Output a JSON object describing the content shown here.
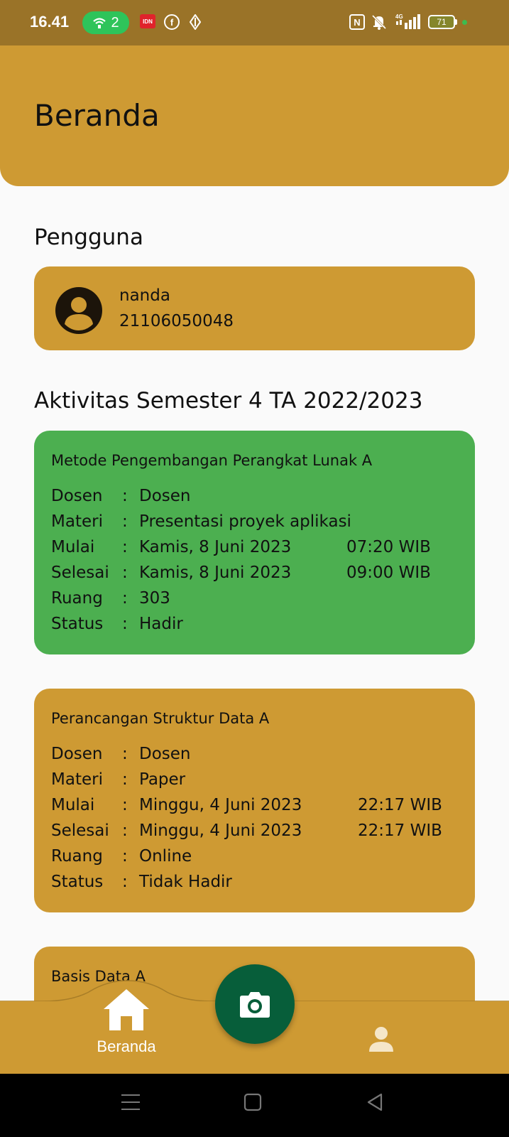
{
  "status_bar": {
    "time": "16.41",
    "hotspot_count": "2",
    "notification_badge": "IDN",
    "facebook_glyph": "f",
    "nfc_glyph": "N",
    "network_type": "4G",
    "battery_level": "71"
  },
  "header": {
    "title": "Beranda"
  },
  "user_section": {
    "heading": "Pengguna",
    "name": "nanda",
    "nim": "21106050048"
  },
  "activity_section": {
    "heading": "Aktivitas Semester 4 TA 2022/2023",
    "field_labels": {
      "dosen": "Dosen",
      "materi": "Materi",
      "mulai": "Mulai",
      "selesai": "Selesai",
      "ruang": "Ruang",
      "status": "Status"
    },
    "separator": ":",
    "activities": [
      {
        "course": "Metode Pengembangan Perangkat Lunak A",
        "dosen": "Dosen",
        "materi": "Presentasi proyek aplikasi",
        "mulai_date": "Kamis, 8 Juni 2023",
        "mulai_time": "07:20 WIB",
        "selesai_date": "Kamis, 8 Juni 2023",
        "selesai_time": "09:00 WIB",
        "ruang": "303",
        "status": "Hadir",
        "card_color": "#4CAF50"
      },
      {
        "course": "Perancangan Struktur Data A",
        "dosen": "Dosen",
        "materi": "Paper",
        "mulai_date": "Minggu, 4 Juni 2023",
        "mulai_time": "22:17 WIB",
        "selesai_date": "Minggu, 4 Juni 2023",
        "selesai_time": "22:17 WIB",
        "ruang": "Online",
        "status": "Tidak Hadir",
        "card_color": "#CE9A33"
      },
      {
        "course": "Basis Data A",
        "card_color": "#CE9A33"
      }
    ]
  },
  "bottom_nav": {
    "home_label": "Beranda",
    "home_icon": "home-icon",
    "fab_icon": "camera-icon",
    "profile_icon": "person-icon"
  },
  "system_nav": {
    "recents_icon": "menu-lines-icon",
    "home_icon": "square-icon",
    "back_icon": "triangle-back-icon"
  },
  "colors": {
    "accent_gold": "#CE9A33",
    "status_bar": "#9A7328",
    "present_green": "#4CAF50",
    "fab_green": "#075E3A",
    "background": "#FAFAFA"
  }
}
